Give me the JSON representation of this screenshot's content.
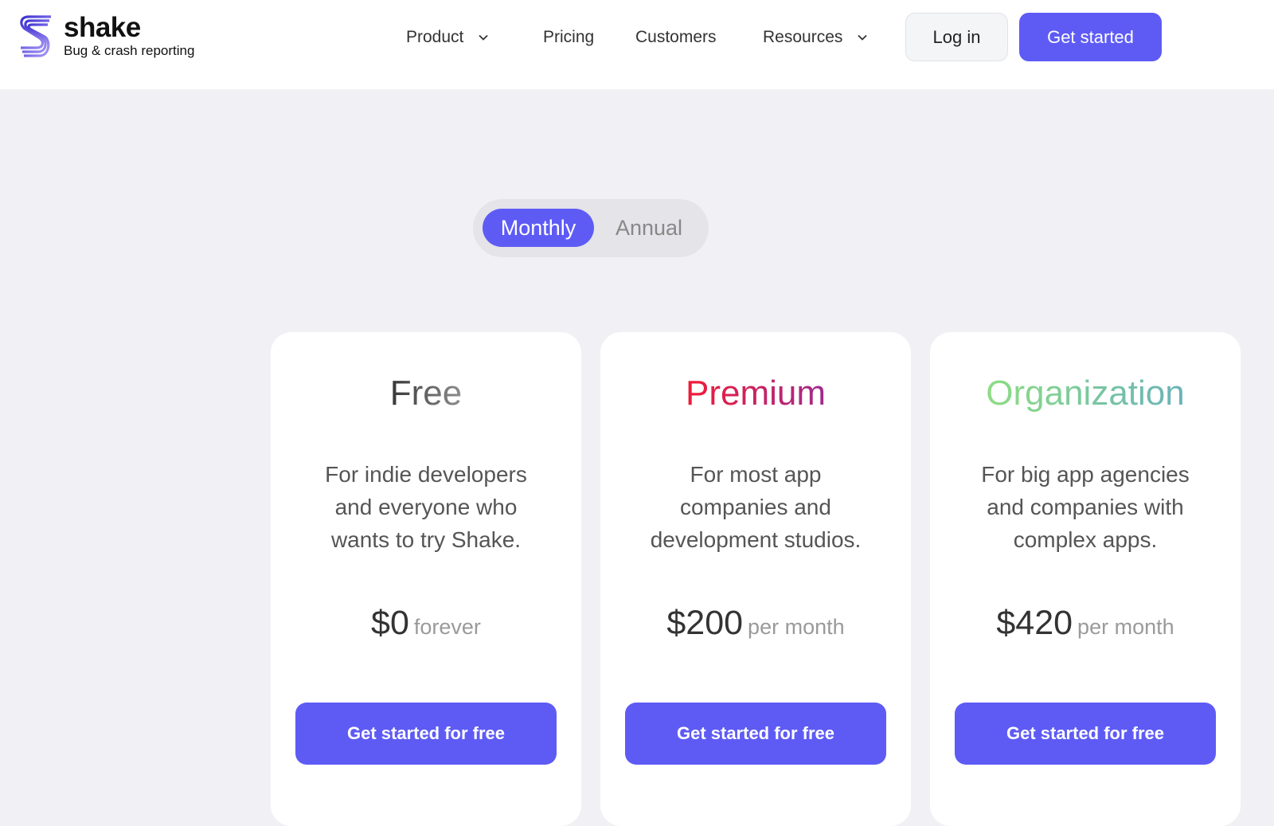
{
  "header": {
    "logo": {
      "name": "shake",
      "tagline": "Bug & crash reporting",
      "icon": "shake-logo-icon"
    },
    "nav": [
      {
        "label": "Product",
        "has_dropdown": true
      },
      {
        "label": "Pricing",
        "has_dropdown": false
      },
      {
        "label": "Customers",
        "has_dropdown": false
      },
      {
        "label": "Resources",
        "has_dropdown": true
      }
    ],
    "login_label": "Log in",
    "get_started_label": "Get started"
  },
  "billing_toggle": {
    "options": [
      "Monthly",
      "Annual"
    ],
    "selected": "Monthly"
  },
  "plans": [
    {
      "title": "Free",
      "title_gradient": [
        "#2a2a2a",
        "#9a9a9a"
      ],
      "description_lines": [
        "For indie developers",
        "and everyone who",
        "wants to try Shake."
      ],
      "price": "$0",
      "period": "forever",
      "cta": "Get started for free"
    },
    {
      "title": "Premium",
      "title_gradient": [
        "#ee1c3a",
        "#a12a8c"
      ],
      "description_lines": [
        "For most app",
        "companies and",
        "development studios."
      ],
      "price": "$200",
      "period": "per month",
      "cta": "Get started for free"
    },
    {
      "title": "Organization",
      "title_gradient": [
        "#8cdc84",
        "#6ab4b8"
      ],
      "description_lines": [
        "For big app agencies",
        "and companies with",
        "complex apps."
      ],
      "price": "$420",
      "period": "per month",
      "cta": "Get started for free"
    }
  ],
  "colors": {
    "accent": "#5e5bf5",
    "page_bg": "#f1f1f5",
    "card_bg": "#ffffff"
  }
}
